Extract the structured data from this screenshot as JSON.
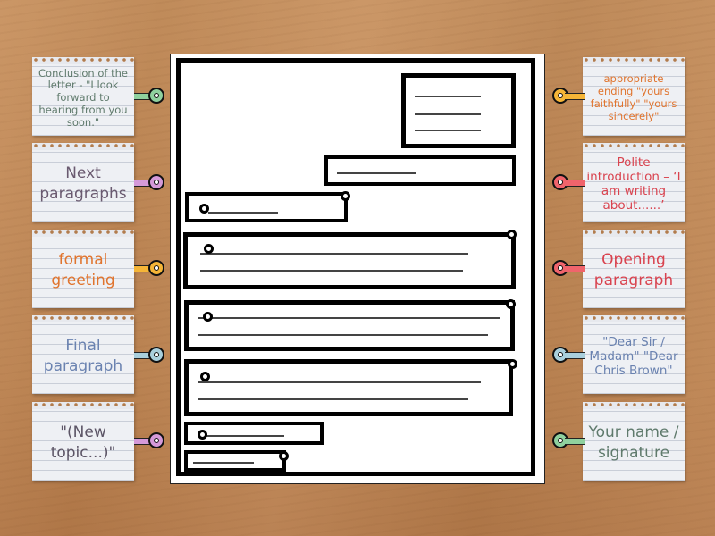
{
  "activity": {
    "type": "labelled diagram",
    "subject": "formal letter layout"
  },
  "left_labels": [
    {
      "text": "Conclusion of the letter - \"I look forward to hearing from you soon.\"",
      "color": "#5f7a6c",
      "pin_color": "#8fd19e"
    },
    {
      "text": "Next paragraphs",
      "color": "#6a5a70",
      "pin_color": "#d59ad9"
    },
    {
      "text": "formal greeting",
      "color": "#e0742e",
      "pin_color": "#f5b537"
    },
    {
      "text": "Final paragraph",
      "color": "#6a82b0",
      "pin_color": "#a9cfdc"
    },
    {
      "text": "\"(New topic...)\"",
      "color": "#5c5566",
      "pin_color": "#d59ad9"
    }
  ],
  "right_labels": [
    {
      "text": "appropriate ending \"yours faithfully\" \"yours sincerely\"",
      "color": "#e0742e",
      "pin_color": "#f5b537"
    },
    {
      "text": "Polite introduction – ‘I am writing about......’",
      "color": "#d9434f",
      "pin_color": "#f0646c"
    },
    {
      "text": "Opening paragraph",
      "color": "#d9434f",
      "pin_color": "#f0646c"
    },
    {
      "text": "\"Dear Sir / Madam\" \"Dear Chris Brown\"",
      "color": "#6a82b0",
      "pin_color": "#a9cfdc"
    },
    {
      "text": "Your name / signature",
      "color": "#5f7a6c",
      "pin_color": "#8fd19e"
    }
  ]
}
